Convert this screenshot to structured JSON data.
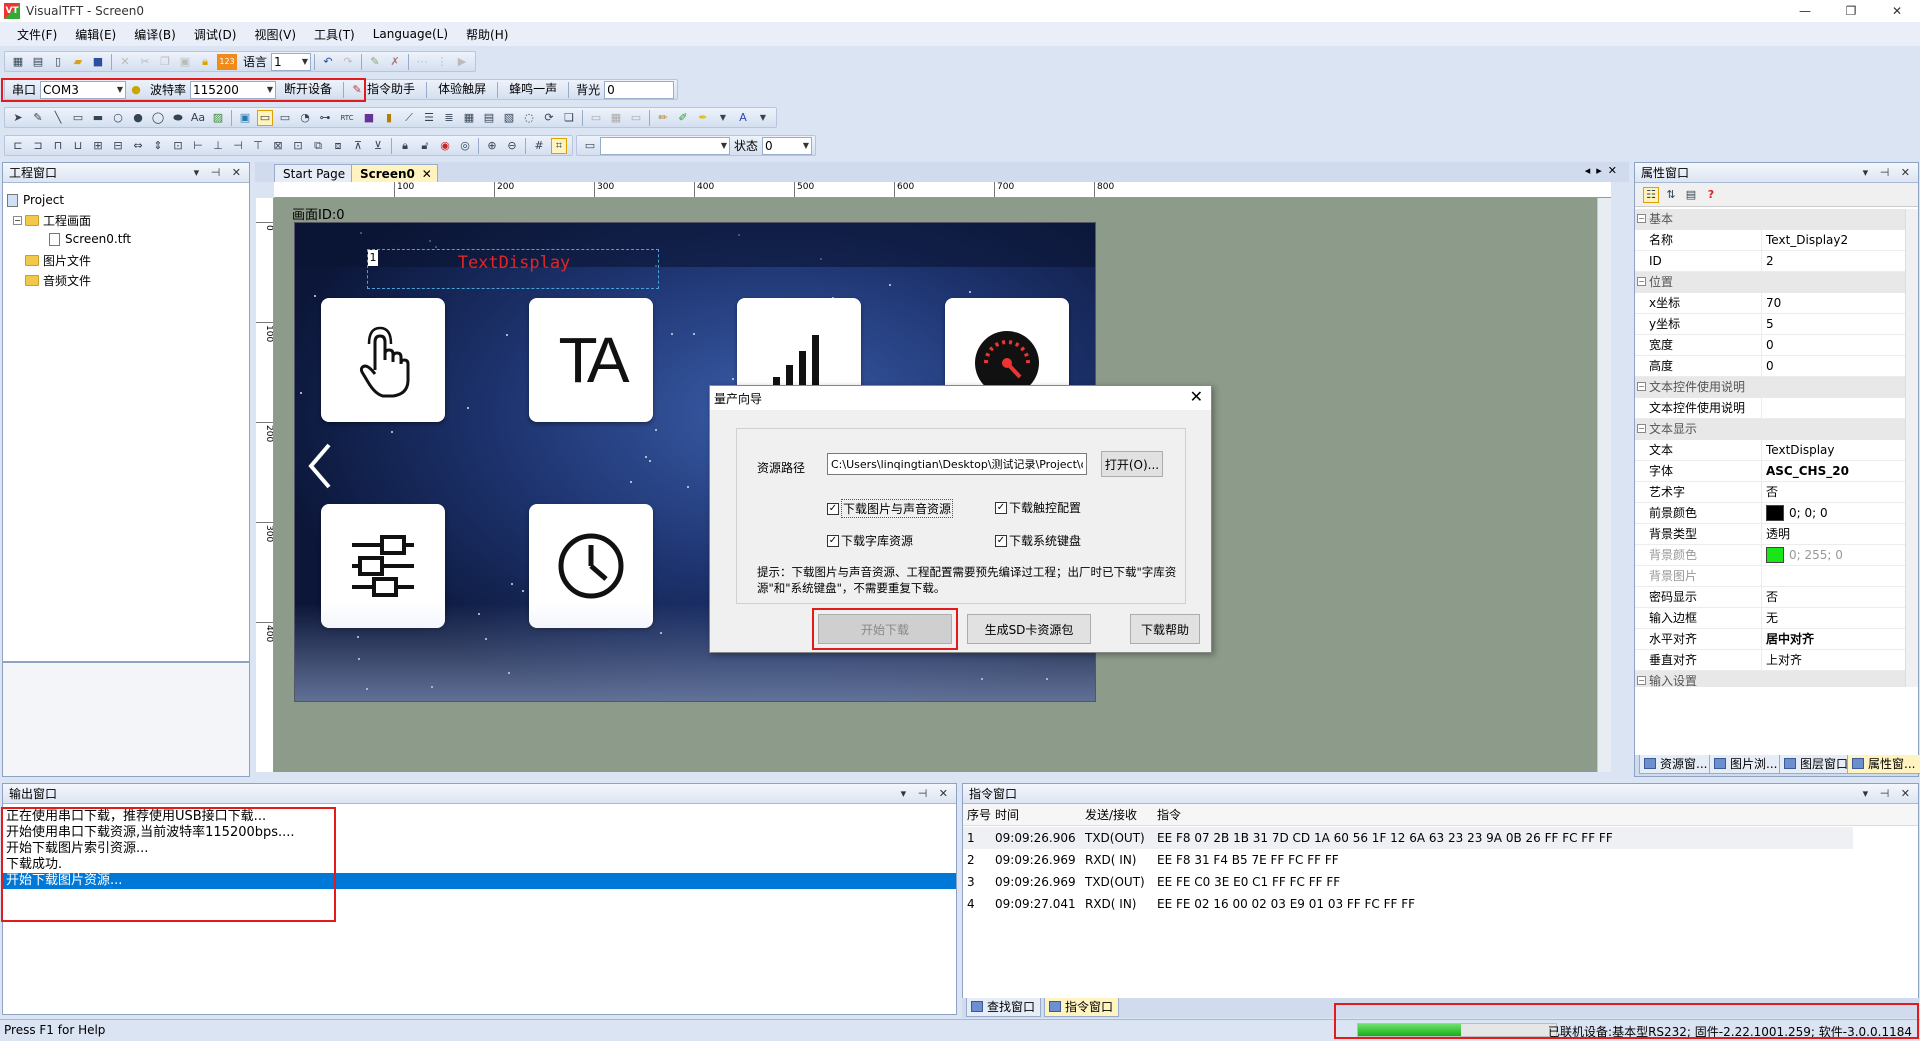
{
  "window": {
    "title": "VisualTFT - Screen0",
    "app_icon": "VT",
    "min": "—",
    "restore": "❐",
    "close": "✕"
  },
  "menu": [
    "文件(F)",
    "编辑(E)",
    "编译(B)",
    "调试(D)",
    "视图(V)",
    "工具(T)",
    "Language(L)",
    "帮助(H)"
  ],
  "toolbar1": {
    "lang_label": "语言",
    "lang_value": "1",
    "lang_icon_text": "123"
  },
  "toolbar2": {
    "port_label": "串口",
    "port_value": "COM3",
    "baud_label": "波特率",
    "baud_value": "115200",
    "disconnect": "断开设备",
    "cmd_helper": "指令助手",
    "touch_exp": "体验触屏",
    "beep": "蜂鸣一声",
    "backlight_label": "背光",
    "backlight_value": "0"
  },
  "toolbar3": {
    "text_tool": "Aa",
    "rtc_tool": "RTC"
  },
  "toolbar4": {
    "state_label": "状态",
    "state_value": "0",
    "combo_value": ""
  },
  "project_panel": {
    "title": "工程窗口",
    "tree": {
      "root": "Project",
      "screens_folder": "工程画面",
      "screen_file": "Screen0.tft",
      "images_folder": "图片文件",
      "audio_folder": "音频文件"
    }
  },
  "editor": {
    "tabs": [
      "Start Page",
      "Screen0"
    ],
    "ruler_h": [
      "100",
      "200",
      "300",
      "400",
      "500",
      "600",
      "700",
      "800"
    ],
    "ruler_v": [
      "0",
      "100",
      "200",
      "300",
      "400"
    ],
    "screen_label": "画面ID:0",
    "text_display": "TextDisplay",
    "text_display_index": "1"
  },
  "dialog": {
    "title": "量产向导",
    "path_label": "资源路径",
    "path_value": "C:\\Users\\linqingtian\\Desktop\\测试记录\\Project\\output",
    "open_button": "打开(O)...",
    "checks": [
      {
        "label": "下载图片与声音资源",
        "checked": true
      },
      {
        "label": "下载触控配置",
        "checked": true
      },
      {
        "label": "下载字库资源",
        "checked": true
      },
      {
        "label": "下载系统键盘",
        "checked": true
      }
    ],
    "hint": "提示：下载图片与声音资源、工程配置需要预先编译过工程；出厂时已下载\"字库资源\"和\"系统键盘\"，不需要重复下载。",
    "start_button": "开始下载",
    "sd_button": "生成SD卡资源包",
    "help_button": "下载帮助"
  },
  "properties": {
    "title": "属性窗口",
    "cats": {
      "basic": "基本",
      "position": "位置",
      "usage": "文本控件使用说明",
      "text": "文本显示",
      "input": "输入设置"
    },
    "rows": [
      {
        "k": "名称",
        "v": "Text_Display2"
      },
      {
        "k": "ID",
        "v": "2"
      },
      {
        "k": "x坐标",
        "v": "70"
      },
      {
        "k": "y坐标",
        "v": "5"
      },
      {
        "k": "宽度",
        "v": "0"
      },
      {
        "k": "高度",
        "v": "0"
      },
      {
        "k": "文本控件使用说明",
        "v": ""
      },
      {
        "k": "文本",
        "v": "TextDisplay"
      },
      {
        "k": "字体",
        "v": "ASC_CHS_20"
      },
      {
        "k": "艺术字",
        "v": "否"
      },
      {
        "k": "前景颜色",
        "v": "0; 0; 0"
      },
      {
        "k": "背景类型",
        "v": "透明"
      },
      {
        "k": "背景颜色",
        "v": "0; 255; 0"
      },
      {
        "k": "背景图片",
        "v": ""
      },
      {
        "k": "密码显示",
        "v": "否"
      },
      {
        "k": "输入边框",
        "v": "无"
      },
      {
        "k": "水平对齐",
        "v": "居中对齐"
      },
      {
        "k": "垂直对齐",
        "v": "上对齐"
      }
    ],
    "fg_color": "#000000",
    "bg_color": "#19e619",
    "bottom_tabs": [
      "资源窗...",
      "图片浏...",
      "图层窗口",
      "属性窗..."
    ]
  },
  "output_panel": {
    "title": "输出窗口",
    "lines": [
      "正在使用串口下载，推荐使用USB接口下载...",
      "开始使用串口下载资源,当前波特率115200bps....",
      "开始下载图片索引资源...",
      "下载成功.",
      "开始下载图片资源..."
    ]
  },
  "cmd_panel": {
    "title": "指令窗口",
    "headers": [
      "序号",
      "时间",
      "发送/接收",
      "指令"
    ],
    "rows": [
      [
        "1",
        "09:09:26.906",
        "TXD(OUT)",
        "EE F8 07 2B 1B 31 7D CD 1A 60 56 1F 12 6A 63 23 23 9A 0B 26 FF FC FF FF"
      ],
      [
        "2",
        "09:09:26.969",
        "RXD( IN)",
        "EE F8 31 F4 B5 7E FF FC FF FF"
      ],
      [
        "3",
        "09:09:26.969",
        "TXD(OUT)",
        "EE FE C0 3E E0 C1 FF FC FF FF"
      ],
      [
        "4",
        "09:09:27.041",
        "RXD( IN)",
        "EE FE 02 16 00 02 03 E9 01 03 FF FC FF FF"
      ]
    ],
    "bottom_tabs": [
      "查找窗口",
      "指令窗口"
    ]
  },
  "status": {
    "help": "Press F1 for Help",
    "device": "已联机设备:基本型RS232; 固件-2.22.1001.259; 软件-3.0.0.1184",
    "progress": 0.52
  },
  "colors": {
    "accent_red": "#e21c1c",
    "selection": "#0078d7",
    "text_display_red": "#e0262b"
  }
}
